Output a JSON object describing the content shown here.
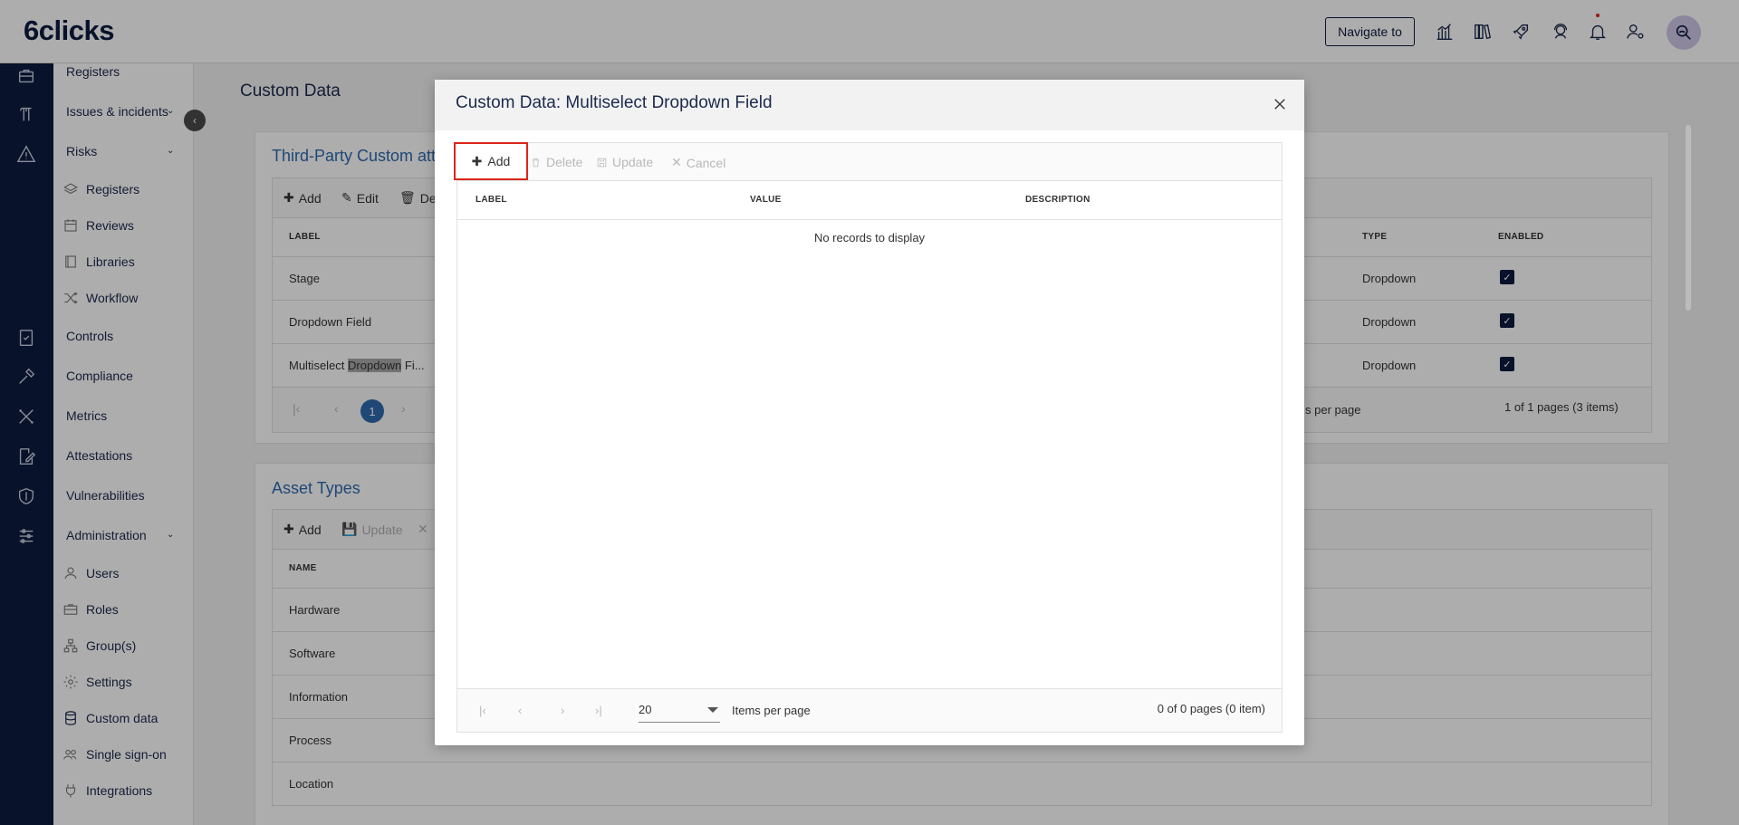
{
  "header": {
    "logo": "6clicks",
    "navigate_label": "Navigate to",
    "icons": [
      "analytics-icon",
      "library-icon",
      "rocket-icon",
      "support-icon",
      "bell-icon",
      "user-settings-icon"
    ],
    "avatar_icon": "search-profile-icon"
  },
  "rail": {
    "icons": [
      "briefcase-icon",
      "tower-icon",
      "warning-icon",
      "checklist-icon",
      "hammer-icon",
      "tools-icon",
      "edit-document-icon",
      "shield-icon",
      "sliders-icon"
    ]
  },
  "sidebar": {
    "registers_top": "Registers",
    "issues": "Issues & incidents",
    "risks": "Risks",
    "risk_items": [
      {
        "label": "Registers",
        "icon": "layers-icon"
      },
      {
        "label": "Reviews",
        "icon": "calendar-icon"
      },
      {
        "label": "Libraries",
        "icon": "book-icon"
      },
      {
        "label": "Workflow",
        "icon": "shuffle-icon"
      }
    ],
    "controls": "Controls",
    "compliance": "Compliance",
    "metrics": "Metrics",
    "attestations": "Attestations",
    "vulnerabilities": "Vulnerabilities",
    "administration": "Administration",
    "admin_items": [
      {
        "label": "Users",
        "icon": "user-icon"
      },
      {
        "label": "Roles",
        "icon": "briefcase-icon"
      },
      {
        "label": "Group(s)",
        "icon": "hierarchy-icon"
      },
      {
        "label": "Settings",
        "icon": "gear-icon"
      },
      {
        "label": "Custom data",
        "icon": "database-icon"
      },
      {
        "label": "Single sign-on",
        "icon": "users-icon"
      },
      {
        "label": "Integrations",
        "icon": "plug-icon"
      }
    ]
  },
  "main": {
    "title": "Custom Data",
    "third_party": {
      "title": "Third-Party Custom att",
      "toolbar": {
        "add": "Add",
        "edit": "Edit",
        "delete": "Del"
      },
      "columns": {
        "label": "LABEL",
        "type": "TYPE",
        "enabled": "ENABLED"
      },
      "rows": [
        {
          "label": "Stage",
          "type": "Dropdown",
          "enabled": true
        },
        {
          "label": "Dropdown Field",
          "type": "Dropdown",
          "enabled": true
        },
        {
          "label_pre": "Multiselect ",
          "label_hl": "Dropdown",
          "label_post": " Fi...",
          "type": "Dropdown",
          "enabled": true
        }
      ],
      "page": "1",
      "per_page_text": "s per page",
      "page_info": "1 of 1 pages (3 items)"
    },
    "asset_types": {
      "title": "Asset Types",
      "toolbar": {
        "add": "Add",
        "update": "Update"
      },
      "columns": {
        "name": "NAME"
      },
      "rows": [
        "Hardware",
        "Software",
        "Information",
        "Process",
        "Location"
      ]
    }
  },
  "modal": {
    "title": "Custom Data: Multiselect Dropdown Field",
    "toolbar": {
      "add": "Add",
      "delete": "Delete",
      "update": "Update",
      "cancel": "Cancel"
    },
    "columns": {
      "label": "LABEL",
      "value": "VALUE",
      "description": "DESCRIPTION"
    },
    "empty_text": "No records to display",
    "page_size": "20",
    "items_per_page": "Items per page",
    "page_info": "0 of 0 pages (0 item)"
  },
  "colors": {
    "navy": "#0d1b3e",
    "accent_blue": "#2f6ab0",
    "highlight_red": "#d9261c"
  }
}
